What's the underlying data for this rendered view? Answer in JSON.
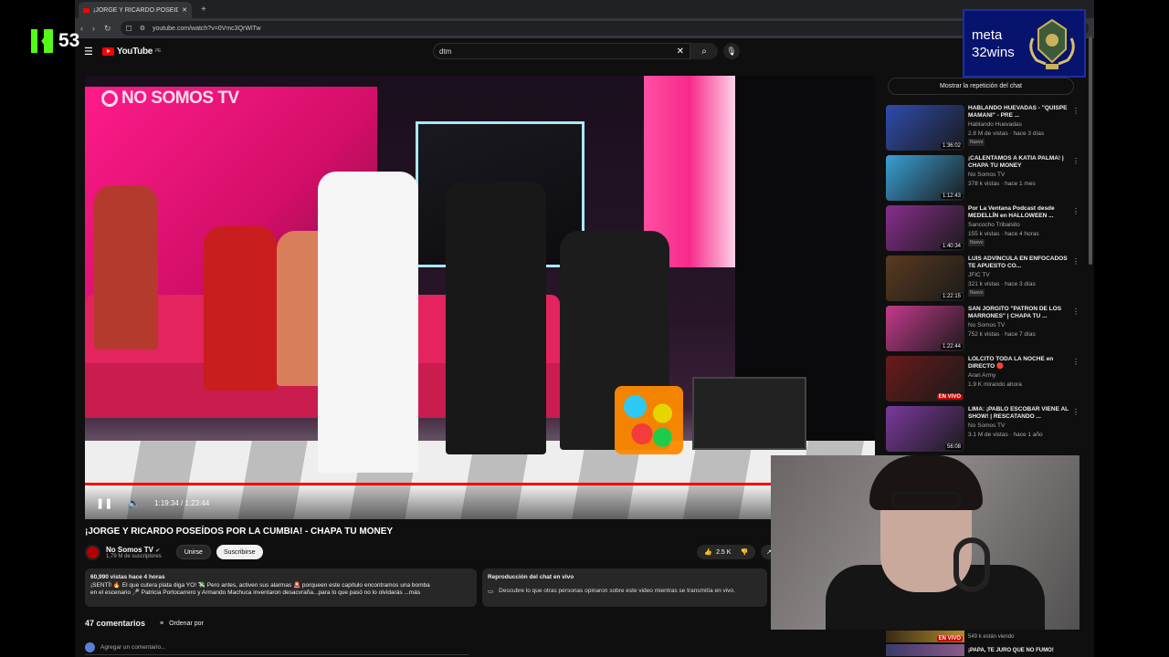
{
  "overlay": {
    "kick_count": "53",
    "meta_line1": "meta",
    "meta_line2": "32wins"
  },
  "browser": {
    "tab_title": "¡JORGE Y RICARDO POSEÍDOS",
    "url": "youtube.com/watch?v=0Vmc3QrWiTw"
  },
  "youtube": {
    "logo_text": "YouTube",
    "logo_country": "PE",
    "search_value": "dtm"
  },
  "player": {
    "brand": "NO SOMOS TV",
    "time": "1:19:34 / 1:23:44",
    "progress_fraction": 0.95
  },
  "video": {
    "title": "¡JORGE Y RICARDO POSEÍDOS POR LA CUMBIA! - CHAPA TU MONEY",
    "channel_name": "No Somos TV",
    "subscribers": "1,79 M de suscriptores",
    "join_label": "Unirse",
    "subscribe_label": "Suscribirse",
    "likes": "2.5 K",
    "share_label": "Co"
  },
  "description": {
    "stats": "60,990 vistas hace 4 horas",
    "line1": "¡SENTÍ! 🔥 El que cutera plata diga YO! 💸 Pero antes, activen sus alarmas 🚨 porqueen este capítulo encontramos una bomba",
    "line2": "en el escenario 🎤 Patricia Portocarrero y Armando Machuca inventaron desacvraña...para lo que pasó no lo olvidarás ...más"
  },
  "chat_replay": {
    "title": "Reproducción del chat en vivo",
    "text": "Descubre lo que otras personas opinaron sobre este video mientras se transmitía en vivo."
  },
  "comments": {
    "count_label": "47 comentarios",
    "sort_label": "Ordenar por",
    "add_placeholder": "Agregar un comentario..."
  },
  "sidebar": {
    "chat_toggle": "Mostrar la repetición del chat",
    "items": [
      {
        "title": "HABLANDO HUEVADAS - \"QUISPE MAMANI\" - PRE ...",
        "channel": "Hablando Huevadas",
        "meta": "2.8 M de vistas · hace 3 días",
        "badge": "Nuevo",
        "duration": "1:36:02",
        "thumb_color": "#2f4cae"
      },
      {
        "title": "¡CALENTAMOS A KATIA PALMA! | CHAPA TU MONEY",
        "channel": "No Somos TV",
        "meta": "378 k vistas · hace 1 mes",
        "badge": "",
        "duration": "1:12:43",
        "thumb_color": "#3aa0d6"
      },
      {
        "title": "Por La Ventana Podcast desde MEDELLÍN en HALLOWEEN ...",
        "channel": "Sancocho Tribalsito",
        "meta": "155 k vistas · hace 4 horas",
        "badge": "Nuevo",
        "duration": "1:40:34",
        "thumb_color": "#8a2e8e"
      },
      {
        "title": "LUIS ADVÍNCULA EN ENFOCADOS TE APUESTO CO...",
        "channel": "JFIC TV",
        "meta": "321 k vistas · hace 3 días",
        "badge": "Nuevo",
        "duration": "1:22:15",
        "thumb_color": "#5a3a20"
      },
      {
        "title": "SAN JORGITO \"PATRÓN DE LOS MARRONES\" | CHAPA TU ...",
        "channel": "No Somos TV",
        "meta": "752 k vistas · hace 7 días",
        "badge": "",
        "duration": "1:22:44",
        "thumb_color": "#c43a8c"
      },
      {
        "title": "LOLCITO TODA LA NOCHE en DIRECTO 🔴",
        "channel": "Arari Army",
        "meta": "1.9 K mirando ahora",
        "badge": "",
        "duration": "EN VIVO",
        "thumb_color": "#6a1a1a"
      },
      {
        "title": "LIMA: ¡PABLO ESCOBAR VIENE AL SHOW! | RESCATANDO ...",
        "channel": "No Somos TV",
        "meta": "3.1 M de vistas · hace 1 año",
        "badge": "",
        "duration": "56:08",
        "thumb_color": "#7a3a9e"
      }
    ],
    "hidden_strip": {
      "line1": "549 k están viendo",
      "badge": "EN VIVO",
      "line2": "¡PAPA, TE JURO QUE NO FUMO!"
    }
  }
}
